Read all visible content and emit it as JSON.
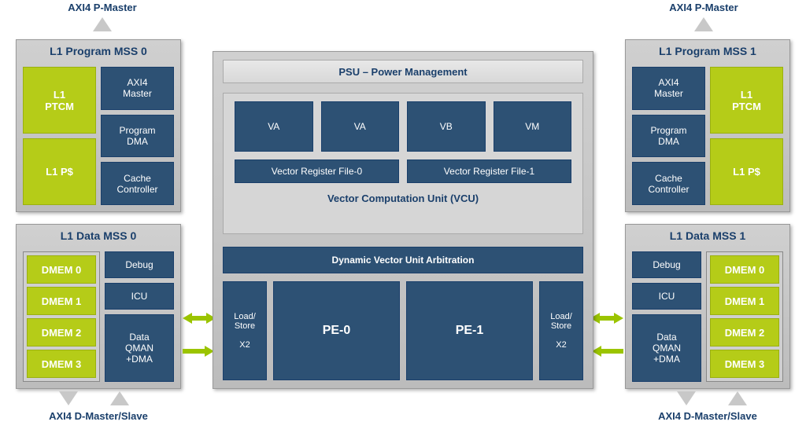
{
  "top_labels": {
    "axi4_pmaster_left": "AXI4 P-Master",
    "axi4_pmaster_right": "AXI4 P-Master"
  },
  "bottom_labels": {
    "axi4_dmaster_left": "AXI4 D-Master/Slave",
    "axi4_dmaster_right": "AXI4 D-Master/Slave"
  },
  "program_mss": {
    "left_title": "L1 Program MSS 0",
    "right_title": "L1 Program MSS 1",
    "ptcm": "L1\nPTCM",
    "pcache": "L1 P$",
    "axi4_master": "AXI4\nMaster",
    "program_dma": "Program\nDMA",
    "cache_ctrl": "Cache\nController"
  },
  "data_mss": {
    "left_title": "L1 Data MSS 0",
    "right_title": "L1 Data MSS 1",
    "dmem": [
      "DMEM 0",
      "DMEM 1",
      "DMEM 2",
      "DMEM 3"
    ],
    "debug": "Debug",
    "icu": "ICU",
    "data_qman": "Data\nQMAN\n+DMA"
  },
  "center": {
    "psu": "PSU – Power Management",
    "vregs": [
      "VA",
      "VA",
      "VB",
      "VM"
    ],
    "vrf0": "Vector Register File-0",
    "vrf1": "Vector Register File-1",
    "vcu": "Vector Computation Unit  (VCU)",
    "dvu": "Dynamic Vector Unit Arbitration",
    "loadstore": "Load/\nStore\n\nX2",
    "pe0": "PE-0",
    "pe1": "PE-1"
  }
}
